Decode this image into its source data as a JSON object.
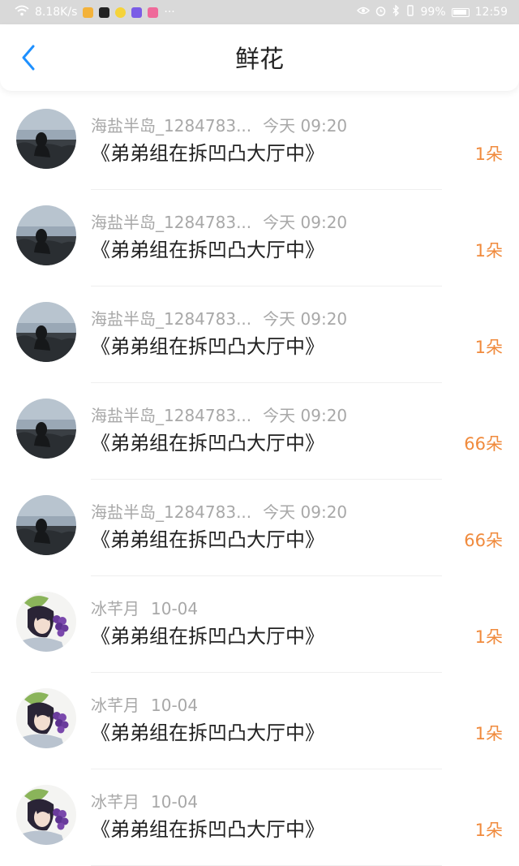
{
  "status_bar": {
    "speed": "8.18K/s",
    "dots": "···",
    "battery_percent": "99%",
    "time": "12:59"
  },
  "header": {
    "title": "鲜花",
    "back_icon": "chevron-left-icon",
    "accent_color": "#1e90ff"
  },
  "list": {
    "items": [
      {
        "name": "海盐半岛_1284783...",
        "time": "今天 09:20",
        "title": "《弟弟组在拆凹凸大厅中》",
        "count": "1朵",
        "avatar": "seaside"
      },
      {
        "name": "海盐半岛_1284783...",
        "time": "今天 09:20",
        "title": "《弟弟组在拆凹凸大厅中》",
        "count": "1朵",
        "avatar": "seaside"
      },
      {
        "name": "海盐半岛_1284783...",
        "time": "今天 09:20",
        "title": "《弟弟组在拆凹凸大厅中》",
        "count": "1朵",
        "avatar": "seaside"
      },
      {
        "name": "海盐半岛_1284783...",
        "time": "今天 09:20",
        "title": "《弟弟组在拆凹凸大厅中》",
        "count": "66朵",
        "avatar": "seaside"
      },
      {
        "name": "海盐半岛_1284783...",
        "time": "今天 09:20",
        "title": "《弟弟组在拆凹凸大厅中》",
        "count": "66朵",
        "avatar": "seaside"
      },
      {
        "name": "冰芊月",
        "time": "10-04",
        "title": "《弟弟组在拆凹凸大厅中》",
        "count": "1朵",
        "avatar": "anime"
      },
      {
        "name": "冰芊月",
        "time": "10-04",
        "title": "《弟弟组在拆凹凸大厅中》",
        "count": "1朵",
        "avatar": "anime"
      },
      {
        "name": "冰芊月",
        "time": "10-04",
        "title": "《弟弟组在拆凹凸大厅中》",
        "count": "1朵",
        "avatar": "anime"
      }
    ]
  },
  "colors": {
    "count": "#f08a3c",
    "meta": "#a8a8a8",
    "status_bar": "#d9d9d9"
  }
}
